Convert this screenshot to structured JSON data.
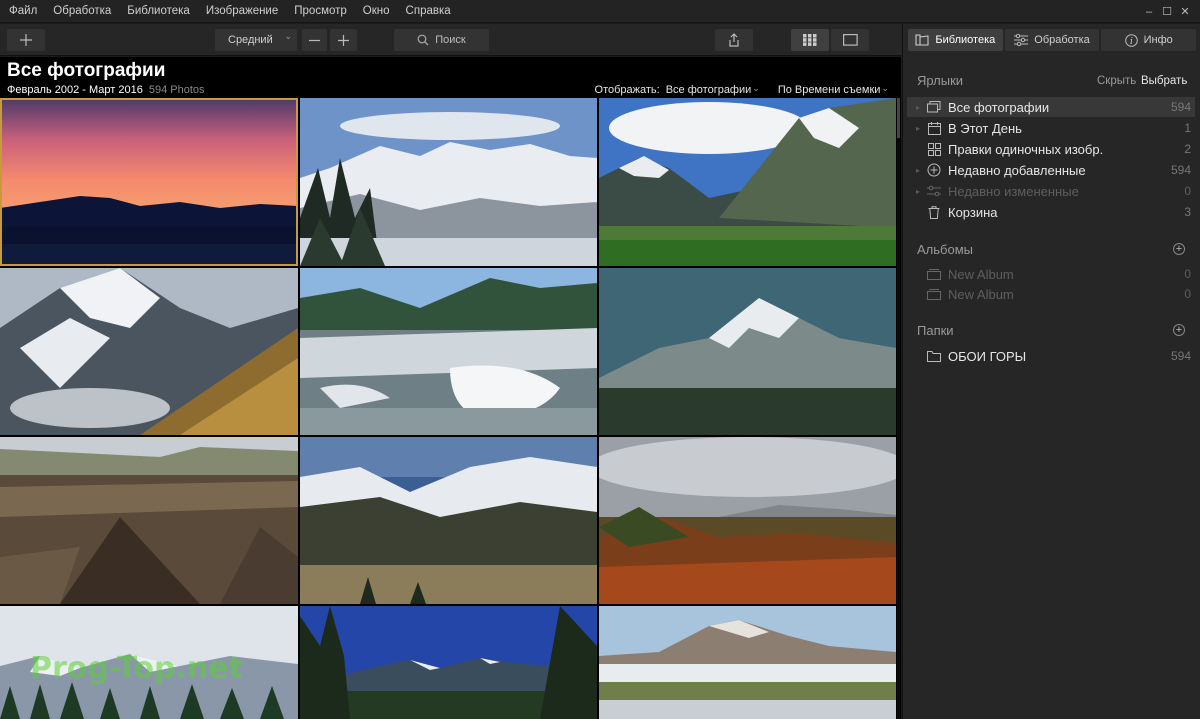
{
  "menu": [
    "Файл",
    "Обработка",
    "Библиотека",
    "Изображение",
    "Просмотр",
    "Окно",
    "Справка"
  ],
  "toolbar": {
    "size_label": "Средний",
    "search_label": "Поиск"
  },
  "panel_tabs": [
    {
      "label": "Библиотека",
      "icon": "library-icon"
    },
    {
      "label": "Обработка",
      "icon": "sliders-icon"
    },
    {
      "label": "Инфо",
      "icon": "info-icon"
    }
  ],
  "content": {
    "title": "Все фотографии",
    "date_range": "Февраль 2002 - Март 2016",
    "photo_count": "594 Photos",
    "show_label": "Отображать:",
    "show_value": "Все фотографии",
    "sort_value": "По Времени съемки"
  },
  "shortcuts": {
    "heading": "Ярлыки",
    "hide": "Скрыть",
    "select": "Выбрать",
    "items": [
      {
        "label": "Все фотографии",
        "count": "594",
        "icon": "photos-icon"
      },
      {
        "label": "В Этот День",
        "count": "1",
        "icon": "calendar-icon"
      },
      {
        "label": "Правки одиночных изобр.",
        "count": "2",
        "icon": "grid-icon"
      },
      {
        "label": "Недавно добавленные",
        "count": "594",
        "icon": "plus-circle-icon"
      },
      {
        "label": "Недавно измененные",
        "count": "0",
        "icon": "sliders-icon"
      },
      {
        "label": "Корзина",
        "count": "3",
        "icon": "trash-icon"
      }
    ]
  },
  "albums": {
    "heading": "Альбомы",
    "items": [
      {
        "label": "New Album",
        "count": "0"
      },
      {
        "label": "New Album",
        "count": "0"
      }
    ]
  },
  "folders": {
    "heading": "Папки",
    "items": [
      {
        "label": "ОБОИ ГОРЫ",
        "count": "594"
      }
    ]
  },
  "watermark": "Prog-Top.net",
  "accent_color": "#c79a3a"
}
